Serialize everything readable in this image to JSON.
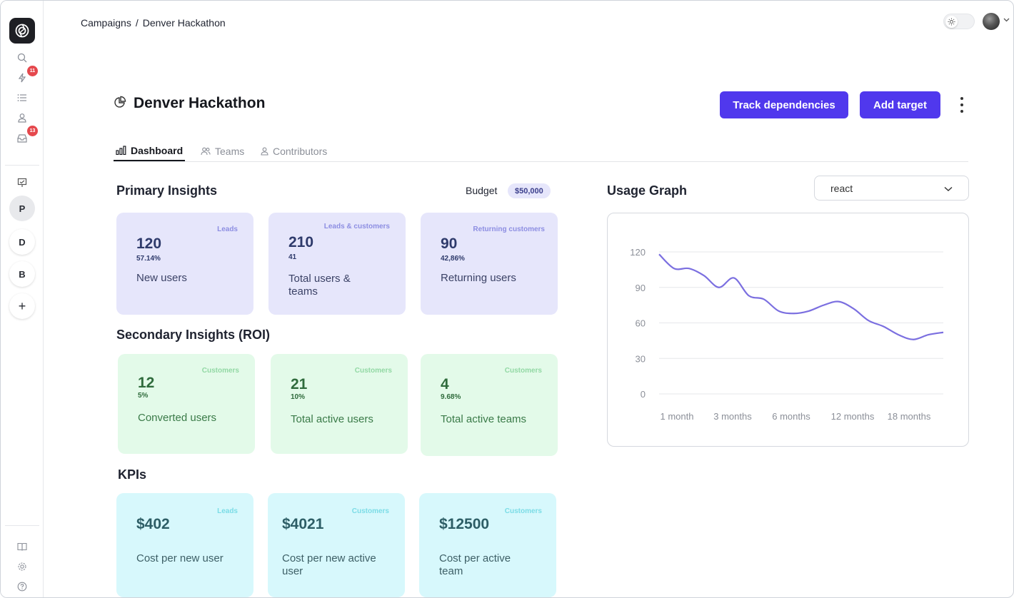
{
  "breadcrumb": {
    "parent": "Campaigns",
    "separator": "/",
    "current": "Denver Hackathon"
  },
  "sidebar": {
    "badges": {
      "activity": "11",
      "inbox": "13"
    },
    "workspaces": [
      "P",
      "D",
      "B",
      "+"
    ]
  },
  "header": {
    "title": "Denver Hackathon",
    "track_button": "Track dependencies",
    "add_button": "Add target"
  },
  "tabs": [
    {
      "label": "Dashboard",
      "active": true
    },
    {
      "label": "Teams",
      "active": false
    },
    {
      "label": "Contributors",
      "active": false
    }
  ],
  "primary": {
    "title": "Primary Insights",
    "budget_label": "Budget",
    "budget_value": "$50,000",
    "cards": [
      {
        "tag": "Leads",
        "value": "120",
        "sub": "57.14%",
        "label": "New users"
      },
      {
        "tag": "Leads & customers",
        "value": "210",
        "sub": "41",
        "label": "Total users & teams"
      },
      {
        "tag": "Returning customers",
        "value": "90",
        "sub": "42,86%",
        "label": "Returning users"
      }
    ]
  },
  "secondary": {
    "title": "Secondary Insights (ROI)",
    "cards": [
      {
        "tag": "Customers",
        "value": "12",
        "sub": "5%",
        "label": "Converted users"
      },
      {
        "tag": "Customers",
        "value": "21",
        "sub": "10%",
        "label": "Total active users"
      },
      {
        "tag": "Customers",
        "value": "4",
        "sub": "9.68%",
        "label": "Total active teams"
      }
    ]
  },
  "kpis": {
    "title": "KPIs",
    "cards": [
      {
        "tag": "Leads",
        "value": "$402",
        "label": "Cost per new user"
      },
      {
        "tag": "Customers",
        "value": "$4021",
        "label": "Cost per new active user"
      },
      {
        "tag": "Customers",
        "value": "$12500",
        "label": "Cost per active team"
      }
    ]
  },
  "usage": {
    "title": "Usage Graph",
    "select_value": "react"
  },
  "chart_data": {
    "type": "line",
    "title": "",
    "xlabel": "",
    "ylabel": "",
    "x_ticks": [
      "1 month",
      "3 months",
      "6 months",
      "12 months",
      "18 months"
    ],
    "y_ticks": [
      0,
      30,
      60,
      90,
      120
    ],
    "ylim": [
      0,
      120
    ],
    "x": [
      0,
      0.5,
      1,
      1.5,
      2,
      2.5,
      3,
      3.5,
      4,
      4.5,
      5,
      5.5,
      6,
      6.5,
      7,
      7.5,
      8,
      8.5,
      9,
      9.5
    ],
    "y": [
      118,
      106,
      106,
      100,
      90,
      98,
      83,
      80,
      70,
      68,
      70,
      75,
      78,
      72,
      62,
      57,
      50,
      46,
      50,
      52
    ],
    "color": "#7b6fe0",
    "grid": true,
    "legend": "none"
  }
}
